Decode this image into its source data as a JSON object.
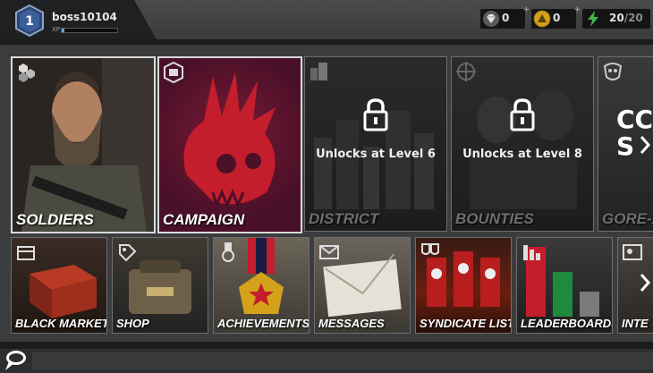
{
  "player": {
    "level": "1",
    "name": "boss10104",
    "xp_label": "XP",
    "xp_progress": 0.05
  },
  "resources": [
    {
      "name": "diamonds",
      "icon": "diamond-icon",
      "value": "0",
      "plus": "+"
    },
    {
      "name": "gold",
      "icon": "gold-coin-icon",
      "value": "0",
      "plus": "+"
    },
    {
      "name": "energy",
      "icon": "lightning-icon",
      "value": "20",
      "max": "/20"
    }
  ],
  "top_cards": [
    {
      "id": "soldiers",
      "label": "SOLDIERS",
      "icon": "hexagons-icon",
      "locked": false
    },
    {
      "id": "campaign",
      "label": "CAMPAIGN",
      "icon": "campaign-emblem-icon",
      "locked": false
    },
    {
      "id": "district",
      "label": "DISTRICT",
      "icon": "buildings-icon",
      "locked": true,
      "lock_text": "Unlocks at Level 6"
    },
    {
      "id": "bounties",
      "label": "BOUNTIES",
      "icon": "crosshair-icon",
      "locked": true,
      "lock_text": "Unlocks at Level 8"
    },
    {
      "id": "gore",
      "label": "GORE-A",
      "overlay_text": "CC S",
      "icon": "mask-icon",
      "locked": false
    }
  ],
  "bottom_cards": [
    {
      "id": "black-market",
      "label": "BLACK MARKET",
      "icon": "crate-icon"
    },
    {
      "id": "shop",
      "label": "SHOP",
      "icon": "shop-tag-icon"
    },
    {
      "id": "achievements",
      "label": "ACHIEVEMENTS",
      "icon": "medal-icon"
    },
    {
      "id": "messages",
      "label": "MESSAGES",
      "icon": "envelope-icon"
    },
    {
      "id": "syndicate-list",
      "label": "SYNDICATE LIST",
      "icon": "shields-icon"
    },
    {
      "id": "leaderboards",
      "label": "LEADERBOARDS",
      "icon": "bar-chart-icon"
    },
    {
      "id": "intel",
      "label": "INTE",
      "icon": "id-card-icon"
    }
  ],
  "colors": {
    "campaign_red": "#c41d2b",
    "energy_green": "#3fb54a",
    "gold": "#d4a21a",
    "badge_blue": "#3b5f9a"
  }
}
